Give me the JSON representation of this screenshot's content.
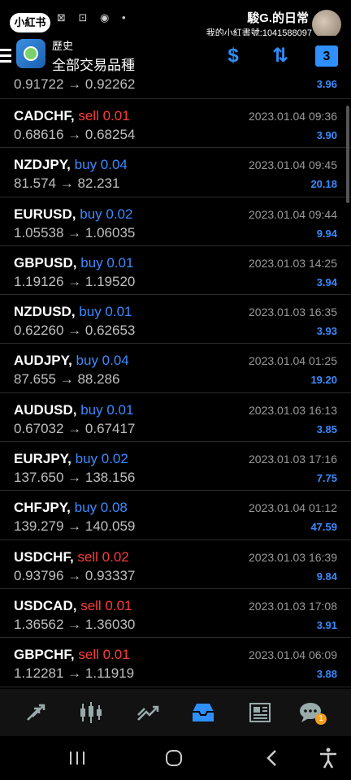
{
  "status": {
    "logo_text": "小紅书",
    "owner_name": "駿G.的日常",
    "owner_id": "我的小紅書號:1041588097"
  },
  "header": {
    "title": "歷史",
    "subtitle": "全部交易品種",
    "calendar_badge": "3"
  },
  "partial_row": {
    "prices": "0.91722 → 0.92262",
    "profit": "3.96"
  },
  "trades": [
    {
      "symbol": "CADCHF,",
      "side": "sell 0.01",
      "type": "sell",
      "prices": "0.68616 → 0.68254",
      "datetime": "2023.01.04 09:36",
      "profit": "3.90"
    },
    {
      "symbol": "NZDJPY,",
      "side": "buy 0.04",
      "type": "buy",
      "prices": "81.574 → 82.231",
      "datetime": "2023.01.04 09:45",
      "profit": "20.18"
    },
    {
      "symbol": "EURUSD,",
      "side": "buy 0.02",
      "type": "buy",
      "prices": "1.05538 → 1.06035",
      "datetime": "2023.01.04 09:44",
      "profit": "9.94"
    },
    {
      "symbol": "GBPUSD,",
      "side": "buy 0.01",
      "type": "buy",
      "prices": "1.19126 → 1.19520",
      "datetime": "2023.01.03 14:25",
      "profit": "3.94"
    },
    {
      "symbol": "NZDUSD,",
      "side": "buy 0.01",
      "type": "buy",
      "prices": "0.62260 → 0.62653",
      "datetime": "2023.01.03 16:35",
      "profit": "3.93"
    },
    {
      "symbol": "AUDJPY,",
      "side": "buy 0.04",
      "type": "buy",
      "prices": "87.655 → 88.286",
      "datetime": "2023.01.04 01:25",
      "profit": "19.20"
    },
    {
      "symbol": "AUDUSD,",
      "side": "buy 0.01",
      "type": "buy",
      "prices": "0.67032 → 0.67417",
      "datetime": "2023.01.03 16:13",
      "profit": "3.85"
    },
    {
      "symbol": "EURJPY,",
      "side": "buy 0.02",
      "type": "buy",
      "prices": "137.650 → 138.156",
      "datetime": "2023.01.03 17:16",
      "profit": "7.75"
    },
    {
      "symbol": "CHFJPY,",
      "side": "buy 0.08",
      "type": "buy",
      "prices": "139.279 → 140.059",
      "datetime": "2023.01.04 01:12",
      "profit": "47.59"
    },
    {
      "symbol": "USDCHF,",
      "side": "sell 0.02",
      "type": "sell",
      "prices": "0.93796 → 0.93337",
      "datetime": "2023.01.03 16:39",
      "profit": "9.84"
    },
    {
      "symbol": "USDCAD,",
      "side": "sell 0.01",
      "type": "sell",
      "prices": "1.36562 → 1.36030",
      "datetime": "2023.01.03 17:08",
      "profit": "3.91"
    },
    {
      "symbol": "GBPCHF,",
      "side": "sell 0.01",
      "type": "sell",
      "prices": "1.12281 → 1.11919",
      "datetime": "2023.01.04 06:09",
      "profit": "3.88"
    }
  ],
  "bottom_nav": {
    "items": [
      "quotes-icon",
      "chart-icon",
      "trade-icon",
      "history-icon",
      "news-icon",
      "chat-icon"
    ],
    "active": "history-icon",
    "chat_badge": "1"
  },
  "colors": {
    "buy": "#3b8bff",
    "sell": "#ff3b3b",
    "accent": "#2f8fff",
    "background": "#000000"
  }
}
